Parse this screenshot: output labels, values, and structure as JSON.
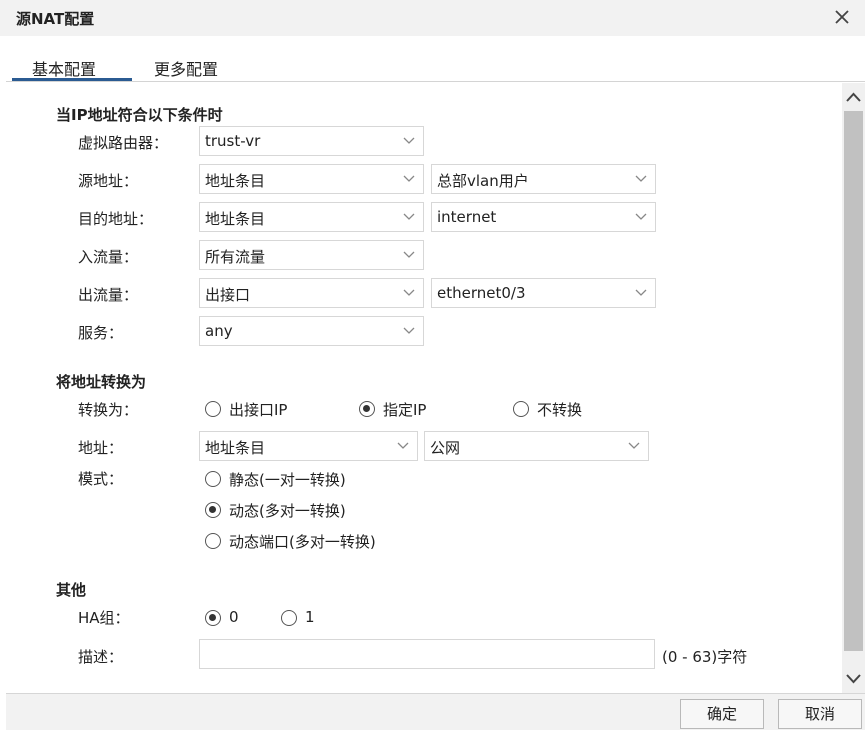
{
  "dialog": {
    "title": "源NAT配置"
  },
  "tabs": [
    {
      "label": "基本配置"
    },
    {
      "label": "更多配置"
    }
  ],
  "conditions": {
    "title": "当IP地址符合以下条件时",
    "virtual_router": {
      "label": "虚拟路由器：",
      "value": "trust-vr"
    },
    "source": {
      "label": "源地址：",
      "type": "地址条目",
      "value": "总部vlan用户"
    },
    "destination": {
      "label": "目的地址：",
      "type": "地址条目",
      "value": "internet"
    },
    "ingress": {
      "label": "入流量：",
      "value": "所有流量"
    },
    "egress": {
      "label": "出流量：",
      "type": "出接口",
      "value": "ethernet0/3"
    },
    "service": {
      "label": "服务：",
      "value": "any"
    }
  },
  "translate": {
    "title": "将地址转换为",
    "to_label": "转换为：",
    "options": [
      {
        "label": "出接口IP",
        "selected": false
      },
      {
        "label": "指定IP",
        "selected": true
      },
      {
        "label": "不转换",
        "selected": false
      }
    ],
    "address": {
      "label": "地址：",
      "type": "地址条目",
      "value": "公网"
    },
    "mode_label": "模式：",
    "modes": [
      {
        "label": "静态(一对一转换)",
        "selected": false
      },
      {
        "label": "动态(多对一转换)",
        "selected": true
      },
      {
        "label": "动态端口(多对一转换)",
        "selected": false
      }
    ]
  },
  "other": {
    "title": "其他",
    "ha_label": "HA组：",
    "ha_options": [
      {
        "label": "0",
        "selected": true
      },
      {
        "label": "1",
        "selected": false
      }
    ],
    "desc_label": "描述：",
    "desc_value": "",
    "desc_hint": "(0 - 63)字符"
  },
  "footer": {
    "ok": "确定",
    "cancel": "取消"
  }
}
